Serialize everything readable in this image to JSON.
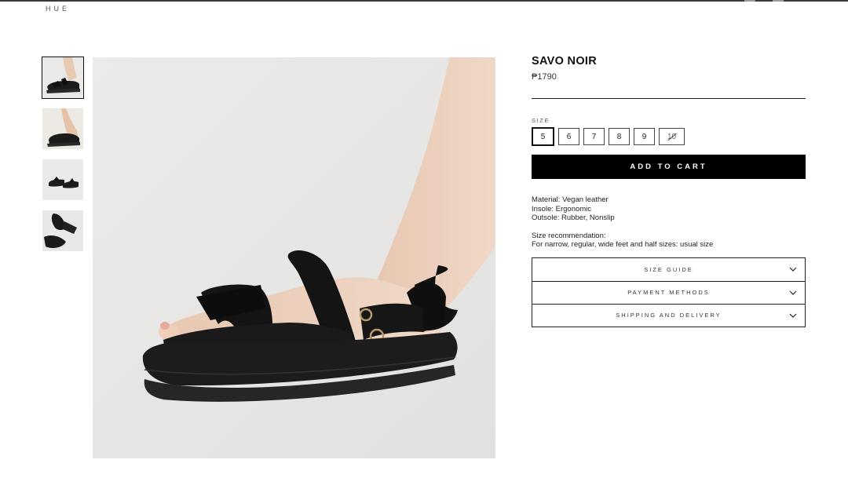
{
  "header": {
    "brand": "HUE"
  },
  "product": {
    "title": "SAVO NOIR",
    "price": "₱1790",
    "size_label": "SIZE",
    "sizes": [
      "5",
      "6",
      "7",
      "8",
      "9",
      "10"
    ],
    "selected_size": "5",
    "sold_out_sizes": [
      "10"
    ],
    "add_to_cart": "ADD TO CART",
    "specs": {
      "material": "Material: Vegan leather",
      "insole": "Insole: Ergonomic",
      "outsole": "Outsole: Rubber, Nonslip"
    },
    "recommendation": {
      "heading": "Size recommendation:",
      "text": "For narrow, regular, wide feet and half sizes: usual size"
    },
    "accordion": [
      {
        "label": "SIZE GUIDE",
        "icon": "chevron-down-icon"
      },
      {
        "label": "PAYMENT METHODS",
        "icon": "chevron-down-icon"
      },
      {
        "label": "SHIPPING AND DELIVERY",
        "icon": "chevron-down-icon"
      }
    ]
  },
  "gallery": {
    "thumbnail_count": 4,
    "active_thumbnail": 1
  },
  "colors": {
    "button_bg": "#000000",
    "button_text": "#ffffff",
    "image_bg": "#e9e8e7"
  }
}
